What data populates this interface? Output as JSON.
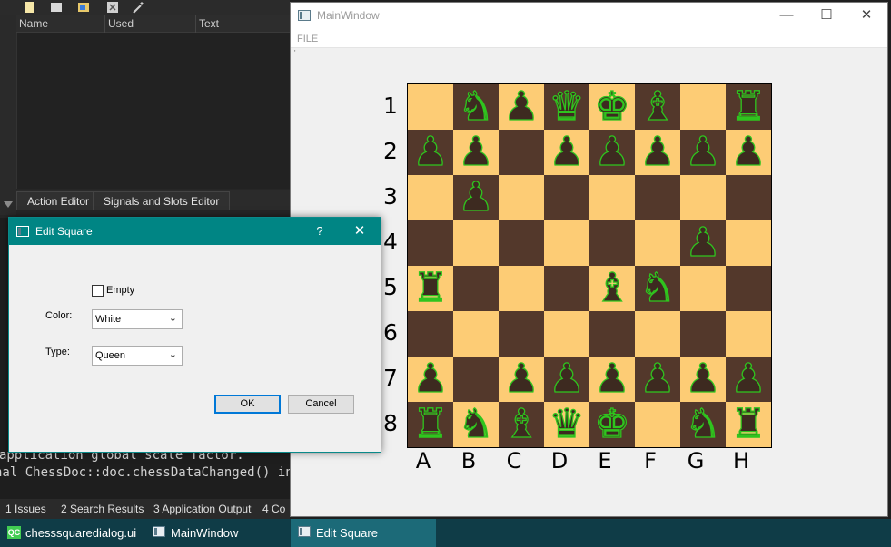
{
  "qt_creator": {
    "column_headers": [
      "Name",
      "Used",
      "Text"
    ],
    "editor_tabs": [
      "Action Editor",
      "Signals and Slots Editor"
    ],
    "output_lines": [
      "application global scale factor.",
      "nal ChessDoc::doc.chessDataChanged() in"
    ],
    "output_tabs": [
      "1  Issues",
      "2  Search Results",
      "3  Application Output",
      "4  Co"
    ]
  },
  "taskbar": {
    "items": [
      "chesssquaredialog.ui ...",
      "MainWindow",
      "Edit Square"
    ],
    "qc_badge": "QC"
  },
  "main_window": {
    "title": "MainWindow",
    "menu": [
      "FILE"
    ],
    "controls": {
      "minimize": "—",
      "maximize": "☐",
      "close": "✕"
    },
    "status_mark": "'",
    "row_labels": [
      "1",
      "2",
      "3",
      "4",
      "5",
      "6",
      "7",
      "8"
    ],
    "col_labels": [
      "A",
      "B",
      "C",
      "D",
      "E",
      "F",
      "G",
      "H"
    ]
  },
  "chess": {
    "square_colors": {
      "light": "#fdcc75",
      "dark": "#53382b"
    },
    "piece_fill": "#3d2a20",
    "piece_outline": "#2fc41e",
    "top_left_square": "light",
    "rows": [
      [
        "",
        "knight",
        "pawn",
        "queen",
        "king",
        "bishop",
        "",
        "rook"
      ],
      [
        "pawn",
        "pawn",
        "",
        "pawn",
        "pawn",
        "pawn",
        "pawn",
        "pawn"
      ],
      [
        "",
        "pawn",
        "",
        "",
        "",
        "",
        "",
        ""
      ],
      [
        "",
        "",
        "",
        "",
        "",
        "",
        "pawn",
        ""
      ],
      [
        "rook",
        "",
        "",
        "",
        "bishop",
        "knight",
        "",
        ""
      ],
      [
        "",
        "",
        "",
        "",
        "",
        "",
        "",
        ""
      ],
      [
        "pawn",
        "",
        "pawn",
        "pawn",
        "pawn",
        "pawn",
        "pawn",
        "pawn"
      ],
      [
        "rook",
        "knight",
        "bishop",
        "queen",
        "king",
        "",
        "knight",
        "rook"
      ]
    ]
  },
  "edit_square_dialog": {
    "title": "Edit Square",
    "help_glyph": "?",
    "close_glyph": "✕",
    "empty_label": "Empty",
    "empty_checked": false,
    "color_label": "Color:",
    "color_value": "White",
    "type_label": "Type:",
    "type_value": "Queen",
    "ok_label": "OK",
    "cancel_label": "Cancel",
    "accent": "#008584"
  }
}
